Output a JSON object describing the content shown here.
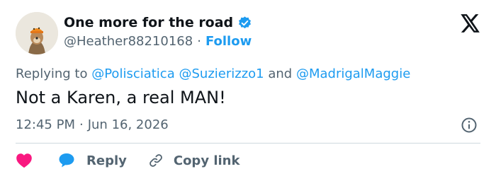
{
  "user": {
    "display_name": "One more for the road",
    "handle": "@Heather88210168",
    "separator": "·",
    "follow_label": "Follow",
    "verified_color": "#1d9bf0"
  },
  "reply_context": {
    "prefix": "Replying to",
    "mention_1": "@Polisciatica",
    "mention_2": "@Suzierizzo1",
    "conjunction": "and",
    "mention_3": "@MadrigalMaggie"
  },
  "tweet": {
    "text": "Not a Karen, a real MAN!",
    "time": "12:45 PM",
    "separator": "·",
    "date": "Jun 16, 2026"
  },
  "actions": {
    "reply_label": "Reply",
    "copy_link_label": "Copy link"
  },
  "colors": {
    "heart": "#f91880",
    "reply_bubble": "#1d9bf0",
    "link": "#1d9bf0",
    "muted": "#536471"
  }
}
